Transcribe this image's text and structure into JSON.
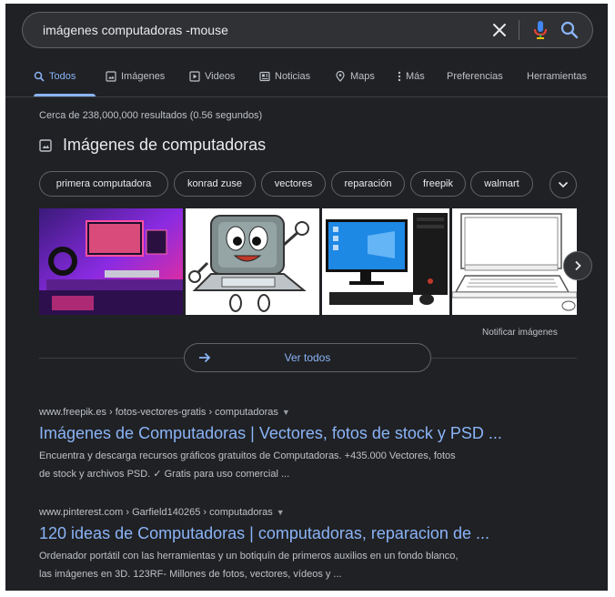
{
  "search": {
    "query": "imágenes computadoras -mouse"
  },
  "tabs": [
    {
      "label": "Todos",
      "icon": "search-icon"
    },
    {
      "label": "Imágenes",
      "icon": "image-icon"
    },
    {
      "label": "Videos",
      "icon": "video-icon"
    },
    {
      "label": "Noticias",
      "icon": "news-icon"
    },
    {
      "label": "Maps",
      "icon": "map-pin-icon"
    },
    {
      "label": "Más",
      "icon": "more-vert-icon"
    },
    {
      "label": "Preferencias"
    },
    {
      "label": "Herramientas"
    }
  ],
  "stats": "Cerca de 238,000,000 resultados (0.56 segundos)",
  "images_block": {
    "heading": "Imágenes de computadoras",
    "chips": [
      "primera computadora",
      "konrad zuse",
      "vectores",
      "reparación",
      "freepik",
      "walmart"
    ],
    "report": "Notificar imágenes",
    "view_all": "Ver todos"
  },
  "results": [
    {
      "breadcrumb": "www.freepik.es › fotos-vectores-gratis › computadoras",
      "title": "Imágenes de Computadoras | Vectores, fotos de stock y PSD ...",
      "snippet_1": "Encuentra y descarga recursos gráficos gratuitos de Computadoras. +435.000 Vectores, fotos",
      "snippet_2": "de stock y archivos PSD. ✓ Gratis para uso comercial ..."
    },
    {
      "breadcrumb": "www.pinterest.com › Garfield140265 › computadoras",
      "title": "120 ideas de Computadoras | computadoras, reparacion de ...",
      "snippet_1": "Ordenador portátil con las herramientas y un botiquín de primeros auxilios en un fondo blanco,",
      "snippet_2": "las imágenes en 3D. 123RF- Millones de fotos, vectores, vídeos y ..."
    }
  ],
  "colors": {
    "background": "#202124",
    "link": "#8ab4f8",
    "text": "#bdc1c6"
  }
}
